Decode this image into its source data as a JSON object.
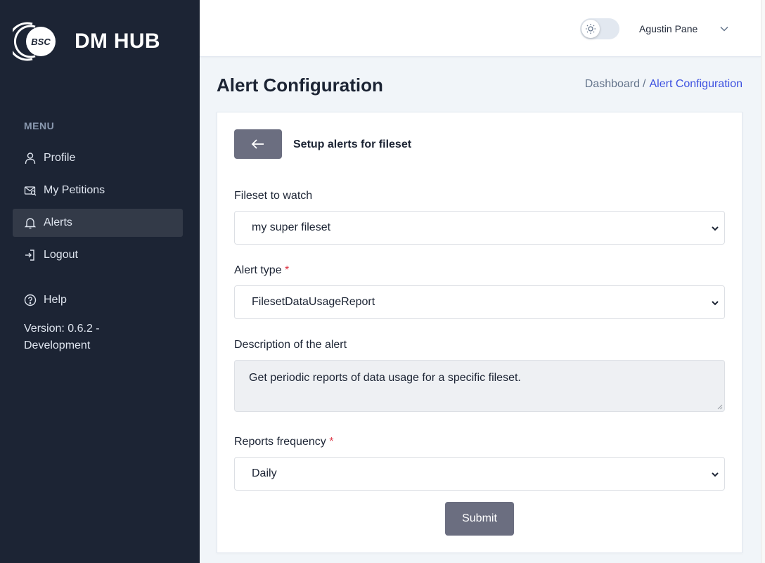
{
  "brand": {
    "logo_text": "BSC",
    "name": "DM HUB"
  },
  "sidebar": {
    "menu_label": "MENU",
    "items": [
      {
        "label": "Profile",
        "icon": "user-icon"
      },
      {
        "label": "My Petitions",
        "icon": "petitions-icon"
      },
      {
        "label": "Alerts",
        "icon": "bell-icon",
        "active": true
      },
      {
        "label": "Logout",
        "icon": "logout-icon"
      },
      {
        "label": "Help",
        "icon": "help-icon"
      }
    ],
    "version": "Version: 0.6.2 - Development"
  },
  "header": {
    "theme_toggle_icon": "sun-icon",
    "user_name": "Agustin Pane"
  },
  "page": {
    "title": "Alert Configuration",
    "breadcrumb": {
      "parent": "Dashboard",
      "separator": "/",
      "current": "Alert Configuration"
    }
  },
  "form": {
    "heading": "Setup alerts for fileset",
    "fileset_label": "Fileset to watch",
    "fileset_value": "my super fileset",
    "alert_type_label": "Alert type",
    "alert_type_value": "FilesetDataUsageReport",
    "required_mark": "*",
    "description_label": "Description of the alert",
    "description_value": "Get periodic reports of data usage for a specific fileset.",
    "frequency_label": "Reports frequency",
    "frequency_value": "Daily",
    "submit_label": "Submit"
  },
  "colors": {
    "sidebar_bg": "#1c2434",
    "active_item_bg": "#333a48",
    "button_bg": "#6b6e80",
    "breadcrumb_active": "#3c50e0",
    "required": "#dc3545"
  }
}
